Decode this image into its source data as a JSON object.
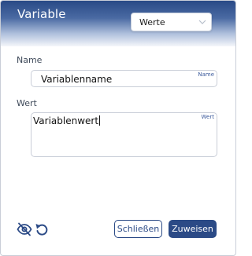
{
  "dialog": {
    "title": "Variable",
    "mode_select": {
      "value": "Werte"
    },
    "name_field": {
      "label": "Name",
      "corner_label": "Name",
      "value": "Variablenname"
    },
    "value_field": {
      "label": "Wert",
      "corner_label": "Wert",
      "value": "Variablenwert"
    },
    "actions": {
      "close_label": "Schließen",
      "assign_label": "Zuweisen"
    }
  },
  "colors": {
    "primary": "#2b4a86",
    "header_gradient_top": "#294a86",
    "field_border": "#c9ced8"
  },
  "icons": {
    "visibility_toggle": "eye-off-icon",
    "reset": "undo-icon",
    "select_chevron": "chevron-down-icon"
  }
}
